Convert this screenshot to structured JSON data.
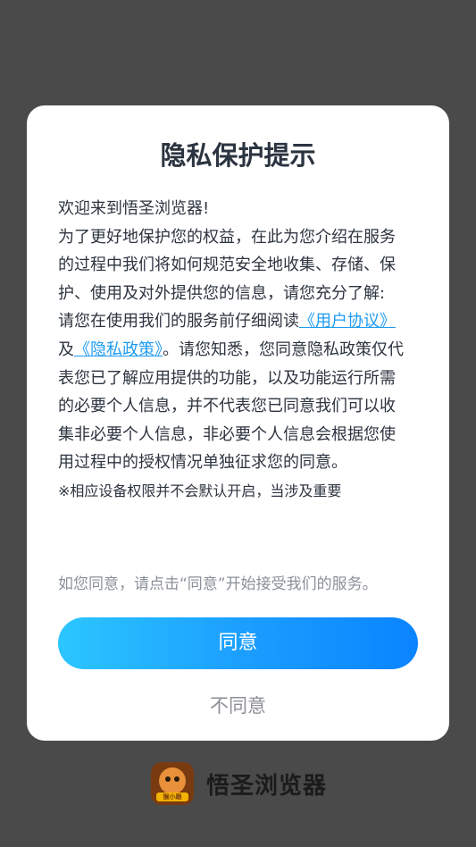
{
  "dialog": {
    "title": "隐私保护提示",
    "paragraphs": {
      "welcome": "欢迎来到悟圣浏览器!",
      "intro": "为了更好地保护您的权益，在此为您介绍在服务的过程中我们将如何规范安全地收集、存储、保护、使用及对外提供您的信息，请您充分了解:",
      "read_prefix": "请您在使用我们的服务前仔细阅读",
      "user_agreement_link": "《用户协议》",
      "and": "及",
      "privacy_policy_link": "《隐私政策》",
      "read_suffix": "。请您知悉，您同意隐私政策仅代表您已了解应用提供的功能，以及功能运行所需的必要个人信息，并不代表您已同意我们可以收集非必要个人信息，非必要个人信息会根据您使用过程中的授权情况单独征求您的同意。",
      "note": "※相应设备权限并不会默认开启，当涉及重要"
    },
    "consent_hint": "如您同意，请点击“同意”开始接受我们的服务。",
    "agree_label": "同意",
    "disagree_label": "不同意"
  },
  "brand": {
    "logo_tag": "猴小跟",
    "name": "悟圣浏览器"
  },
  "colors": {
    "overlay": "#4a4a4a",
    "link": "#1e9bf0",
    "button_gradient_start": "#2cc6ff",
    "button_gradient_end": "#0a84ff"
  }
}
